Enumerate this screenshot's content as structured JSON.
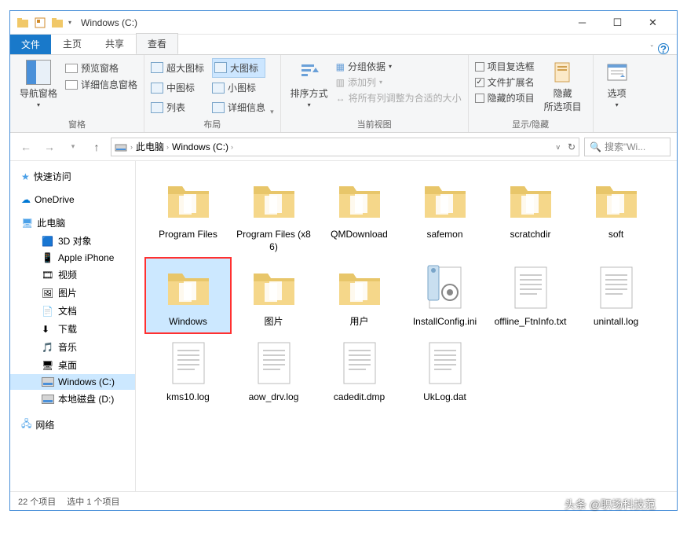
{
  "title": "Windows (C:)",
  "tabs": {
    "file": "文件",
    "home": "主页",
    "share": "共享",
    "view": "查看"
  },
  "ribbon": {
    "nav_pane": "导航窗格",
    "preview_pane": "预览窗格",
    "details_pane": "详细信息窗格",
    "group_panes": "窗格",
    "extra_large": "超大图标",
    "large": "大图标",
    "medium": "中图标",
    "small": "小图标",
    "list": "列表",
    "details": "详细信息",
    "group_layout": "布局",
    "sort_by": "排序方式",
    "group_by": "分组依据",
    "add_column": "添加列",
    "autosize": "将所有列调整为合适的大小",
    "group_view": "当前视图",
    "item_checkboxes": "项目复选框",
    "file_ext": "文件扩展名",
    "hidden_items": "隐藏的项目",
    "hide_selected": "隐藏\n所选项目",
    "group_showhide": "显示/隐藏",
    "options": "选项"
  },
  "breadcrumb": {
    "pc": "此电脑",
    "drive": "Windows (C:)"
  },
  "search_placeholder": "搜索\"Wi...",
  "sidebar": {
    "quick": "快速访问",
    "onedrive": "OneDrive",
    "pc": "此电脑",
    "items": [
      "3D 对象",
      "Apple iPhone",
      "视频",
      "图片",
      "文档",
      "下载",
      "音乐",
      "桌面",
      "Windows (C:)",
      "本地磁盘 (D:)"
    ],
    "network": "网络"
  },
  "files": [
    {
      "name": "Program Files",
      "type": "folder"
    },
    {
      "name": "Program Files (x86)",
      "type": "folder"
    },
    {
      "name": "QMDownload",
      "type": "folder"
    },
    {
      "name": "safemon",
      "type": "folder"
    },
    {
      "name": "scratchdir",
      "type": "folder"
    },
    {
      "name": "soft",
      "type": "folder"
    },
    {
      "name": "Windows",
      "type": "folder",
      "selected": true
    },
    {
      "name": "图片",
      "type": "folder"
    },
    {
      "name": "用户",
      "type": "folder"
    },
    {
      "name": "InstallConfig.ini",
      "type": "ini"
    },
    {
      "name": "offline_FtnInfo.txt",
      "type": "txt"
    },
    {
      "name": "unintall.log",
      "type": "txt"
    },
    {
      "name": "kms10.log",
      "type": "txt"
    },
    {
      "name": "aow_drv.log",
      "type": "txt"
    },
    {
      "name": "cadedit.dmp",
      "type": "txt"
    },
    {
      "name": "UkLog.dat",
      "type": "txt"
    }
  ],
  "status": {
    "count": "22 个项目",
    "selected": "选中 1 个项目"
  },
  "watermark": "头条 @职场科技范"
}
